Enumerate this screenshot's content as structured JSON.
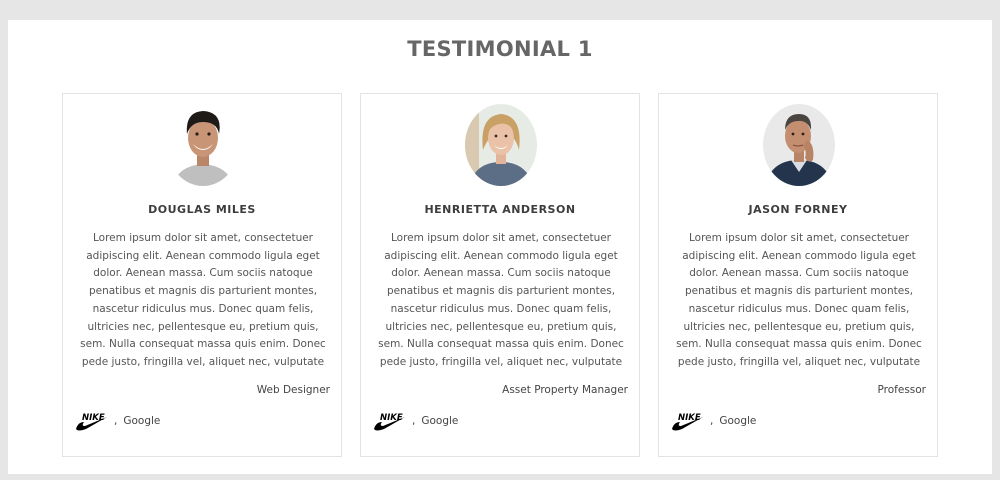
{
  "section": {
    "title": "TESTIMONIAL 1"
  },
  "testimonials": [
    {
      "name": "DOUGLAS MILES",
      "quote": "Lorem ipsum dolor sit amet, consectetuer adipiscing elit. Aenean commodo ligula eget dolor. Aenean massa. Cum sociis natoque penatibus et magnis dis parturient montes, nascetur ridiculus mus. Donec quam felis, ultricies nec, pellentesque eu, pretium quis, sem. Nulla consequat massa quis enim. Donec pede justo, fringilla vel, aliquet nec, vulputate",
      "role": "Web Designer",
      "brand_logo": "nike-swoosh-logo",
      "brand_logo_text": "NIKE",
      "separator": ",",
      "company": "Google"
    },
    {
      "name": "HENRIETTA ANDERSON",
      "quote": "Lorem ipsum dolor sit amet, consectetuer adipiscing elit. Aenean commodo ligula eget dolor. Aenean massa. Cum sociis natoque penatibus et magnis dis parturient montes, nascetur ridiculus mus. Donec quam felis, ultricies nec, pellentesque eu, pretium quis, sem. Nulla consequat massa quis enim. Donec pede justo, fringilla vel, aliquet nec, vulputate",
      "role": "Asset Property Manager",
      "brand_logo": "nike-swoosh-logo",
      "brand_logo_text": "NIKE",
      "separator": ",",
      "company": "Google"
    },
    {
      "name": "JASON FORNEY",
      "quote": "Lorem ipsum dolor sit amet, consectetuer adipiscing elit. Aenean commodo ligula eget dolor. Aenean massa. Cum sociis natoque penatibus et magnis dis parturient montes, nascetur ridiculus mus. Donec quam felis, ultricies nec, pellentesque eu, pretium quis, sem. Nulla consequat massa quis enim. Donec pede justo, fringilla vel, aliquet nec, vulputate",
      "role": "Professor",
      "brand_logo": "nike-swoosh-logo",
      "brand_logo_text": "NIKE",
      "separator": ",",
      "company": "Google"
    }
  ],
  "colors": {
    "page_background": "#e6e6e6",
    "panel_background": "#ffffff",
    "card_border": "#e3e3e3",
    "title_text": "#666666",
    "name_text": "#3d3d3d",
    "body_text": "#555555"
  }
}
